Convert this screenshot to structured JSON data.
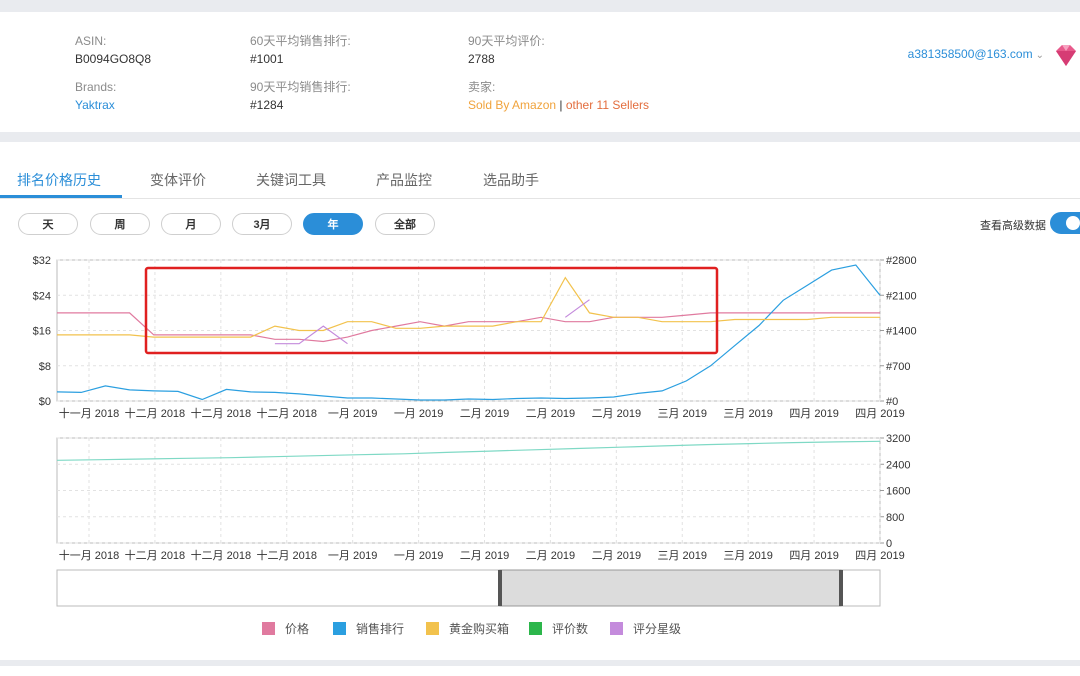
{
  "product": {
    "asin_label": "ASIN:",
    "asin": "B0094GO8Q8",
    "brands_label": "Brands:",
    "brand": "Yaktrax",
    "rank60_label": "60天平均销售排行:",
    "rank60": "#1001",
    "rank90_label": "90天平均销售排行:",
    "rank90": "#1284",
    "rating90_label": "90天平均评价:",
    "rating90": "2788",
    "seller_label": "卖家:",
    "seller_amazon": "Sold By Amazon",
    "seller_sep": "|",
    "seller_other": "other 11 Sellers"
  },
  "account": {
    "email": "a381358500@163.com",
    "chevron": "⌄",
    "gem_icon": "gem-icon"
  },
  "tabs": [
    {
      "label": "排名价格历史",
      "active": true
    },
    {
      "label": "变体评价"
    },
    {
      "label": "关键词工具"
    },
    {
      "label": "产品监控"
    },
    {
      "label": "选品助手"
    }
  ],
  "ranges": [
    {
      "label": "天"
    },
    {
      "label": "周"
    },
    {
      "label": "月"
    },
    {
      "label": "3月"
    },
    {
      "label": "年",
      "active": true
    },
    {
      "label": "全部"
    }
  ],
  "advanced_label": "查看高级数据",
  "colors": {
    "price": "#e07a9f",
    "rank": "#2b9fe0",
    "buybox": "#f2c24d",
    "review_count": "#2cb64b",
    "rating": "#c48bdc",
    "review_line": "#7fd9c5",
    "highlight": "#e02020",
    "accent": "#2b8ed8"
  },
  "chart_data": [
    {
      "type": "line",
      "y_left_ticks": [
        "$32",
        "$24",
        "$16",
        "$8",
        "$0"
      ],
      "y_right_ticks": [
        "#2800",
        "#2100",
        "#1400",
        "#700",
        "#0"
      ],
      "x_ticks": [
        "十一月 2018",
        "十二月 2018",
        "十二月 2018",
        "十二月 2018",
        "一月 2019",
        "一月 2019",
        "二月 2019",
        "二月 2019",
        "二月 2019",
        "三月 2019",
        "三月 2019",
        "四月 2019",
        "四月 2019"
      ],
      "ylim_left": [
        0,
        32
      ],
      "ylim_right": [
        0,
        2800
      ],
      "series": [
        {
          "name": "价格",
          "axis": "left",
          "values": [
            20,
            20,
            20,
            20,
            15,
            15,
            15,
            15,
            15,
            14,
            14,
            13.5,
            14.5,
            16,
            17,
            18,
            17,
            18,
            18,
            18,
            19,
            18,
            18,
            19,
            19,
            19,
            19.5,
            20,
            20,
            20,
            20,
            20,
            20,
            20,
            20
          ]
        },
        {
          "name": "销售排行",
          "axis": "right",
          "values": [
            180,
            170,
            300,
            220,
            200,
            190,
            30,
            230,
            180,
            170,
            140,
            100,
            60,
            60,
            40,
            20,
            20,
            40,
            30,
            50,
            60,
            50,
            60,
            80,
            150,
            200,
            400,
            700,
            1100,
            1500,
            2000,
            2300,
            2600,
            2700,
            2100
          ]
        },
        {
          "name": "黄金购买箱",
          "axis": "left",
          "values": [
            15,
            15,
            15,
            15,
            14.5,
            14.5,
            14.5,
            14.5,
            14.5,
            17,
            16,
            16,
            18,
            18,
            16.5,
            16.5,
            17,
            17,
            17,
            18,
            18,
            28,
            20,
            19,
            19,
            18,
            18,
            18,
            18.5,
            18.5,
            18.5,
            18.5,
            19,
            19,
            19
          ]
        },
        {
          "name": "评分星级",
          "axis": "left",
          "values": [
            null,
            null,
            null,
            null,
            null,
            null,
            null,
            null,
            null,
            13,
            13,
            17,
            13,
            null,
            null,
            null,
            null,
            null,
            null,
            null,
            null,
            19,
            23,
            null,
            null,
            null,
            null,
            null,
            null,
            null,
            null,
            null,
            null,
            null,
            null
          ]
        }
      ]
    },
    {
      "type": "line",
      "y_ticks": [
        "3200",
        "2400",
        "1600",
        "800",
        "0"
      ],
      "ylim": [
        0,
        3200
      ],
      "x_ticks": [
        "十一月 2018",
        "十二月 2018",
        "十二月 2018",
        "十二月 2018",
        "一月 2019",
        "一月 2019",
        "二月 2019",
        "二月 2019",
        "二月 2019",
        "三月 2019",
        "三月 2019",
        "四月 2019",
        "四月 2019"
      ],
      "series": [
        {
          "name": "评价数",
          "values": [
            2520,
            2540,
            2560,
            2580,
            2600,
            2630,
            2660,
            2690,
            2720,
            2760,
            2800,
            2840,
            2880,
            2920,
            2960,
            3000,
            3030,
            3060,
            3080,
            3100
          ]
        }
      ]
    }
  ],
  "legend": [
    {
      "label": "价格",
      "color": "#e07a9f"
    },
    {
      "label": "销售排行",
      "color": "#2b9fe0"
    },
    {
      "label": "黄金购买箱",
      "color": "#f2c24d"
    },
    {
      "label": "评价数",
      "color": "#2cb64b"
    },
    {
      "label": "评分星级",
      "color": "#c48bdc"
    }
  ]
}
